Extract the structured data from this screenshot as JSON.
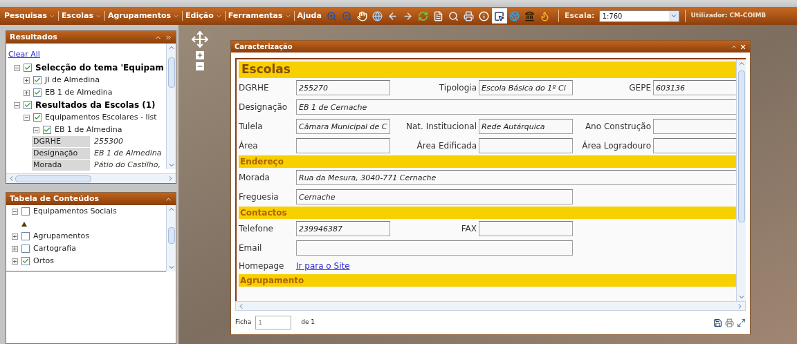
{
  "menu": [
    {
      "label": "Pesquisas",
      "dropdown": true
    },
    {
      "label": "Escolas",
      "dropdown": true
    },
    {
      "label": "Agrupamentos",
      "dropdown": true
    },
    {
      "label": "Edição",
      "dropdown": true
    },
    {
      "label": "Ferramentas",
      "dropdown": true
    },
    {
      "label": "Ajuda",
      "dropdown": false
    }
  ],
  "tools": [
    {
      "kind": "zoom-in",
      "selected": false
    },
    {
      "kind": "zoom-out",
      "selected": false
    },
    {
      "kind": "pan",
      "selected": false
    },
    {
      "kind": "globe",
      "selected": false
    },
    {
      "kind": "back",
      "selected": false
    },
    {
      "kind": "forward",
      "selected": false
    },
    {
      "kind": "refresh",
      "selected": false
    },
    {
      "kind": "document",
      "selected": false
    },
    {
      "kind": "find",
      "selected": false
    },
    {
      "kind": "print",
      "selected": false
    },
    {
      "kind": "info",
      "selected": false
    },
    {
      "kind": "select",
      "selected": true
    },
    {
      "kind": "earth",
      "selected": false
    },
    {
      "kind": "landmark",
      "selected": false
    },
    {
      "kind": "flame",
      "selected": false
    }
  ],
  "scale": {
    "label": "Escala:",
    "value": "1:760"
  },
  "user": "Utilizador: CM-COIMB",
  "results": {
    "title": "Resultados",
    "clear_all": "Clear All",
    "tree": [
      {
        "label": "Selecção do tema 'Equipam",
        "checked": true,
        "expanded": true,
        "children": [
          {
            "label": "JI de Almedina",
            "checked": true,
            "expanded": false
          },
          {
            "label": "EB 1 de Almedina",
            "checked": true,
            "expanded": false
          }
        ]
      },
      {
        "label": "Resultados da Escolas (1)",
        "checked": true,
        "expanded": true,
        "children": [
          {
            "label": "Equipamentos Escolares - list",
            "checked": true,
            "expanded": true,
            "children": [
              {
                "label": "EB 1 de Almedina",
                "checked": true,
                "expanded": true,
                "attributes": [
                  {
                    "label": "DGRHE",
                    "value": "255300"
                  },
                  {
                    "label": "Designação",
                    "value": "EB 1 de Almedina"
                  },
                  {
                    "label": "Morada",
                    "value": "Pátio do Castilho,"
                  }
                ]
              }
            ]
          }
        ]
      }
    ]
  },
  "contents": {
    "title": "Tabela de Conteúdos",
    "tree": [
      {
        "label": "Equipamentos Sociais",
        "checked": false,
        "expanded": true,
        "legend_symbol": true
      },
      {
        "label": "Agrupamentos",
        "checked": false,
        "expanded": false
      },
      {
        "label": "Cartografia",
        "checked": false,
        "expanded": false
      },
      {
        "label": "Ortos",
        "checked": true,
        "expanded": false
      }
    ]
  },
  "dialog": {
    "title": "Caracterização",
    "sections": [
      {
        "kind": "main",
        "title": "Escolas",
        "rows": [
          [
            {
              "label": "DGRHE",
              "value": "255270",
              "kind": "short"
            },
            {
              "label": "Tipologia",
              "value": "Escola Básica do 1º Ci",
              "kind": "short"
            },
            {
              "label": "GEPE",
              "value": "603136",
              "kind": "short"
            }
          ],
          [
            {
              "label": "Designação",
              "value": "EB 1 de Cernache",
              "kind": "long"
            }
          ],
          [
            {
              "label": "Tulela",
              "value": "Câmara Municipal de C",
              "kind": "short"
            },
            {
              "label": "Nat. Institucional",
              "value": "Rede Autárquica",
              "kind": "short"
            },
            {
              "label": "Ano Construção",
              "kind": "short"
            }
          ],
          [
            {
              "label": "Área",
              "kind": "short"
            },
            {
              "label": "Área Edificada",
              "kind": "short"
            },
            {
              "label": "Área Logradouro",
              "kind": "short"
            }
          ]
        ]
      },
      {
        "kind": "sub",
        "title": "Endereço",
        "rows": [
          [
            {
              "label": "Morada",
              "value": "Rua da Mesura, 3040-771 Cernache",
              "kind": "long"
            }
          ],
          [
            {
              "label": "Freguesia",
              "value": "Cernache",
              "kind": "medium"
            }
          ]
        ]
      },
      {
        "kind": "sub",
        "title": "Contactos",
        "rows": [
          [
            {
              "label": "Telefone",
              "value": "239946387",
              "kind": "short"
            },
            {
              "label": "FAX",
              "kind": "short"
            }
          ],
          [
            {
              "label": "Email",
              "kind": "medium"
            }
          ],
          [
            {
              "label": "Homepage",
              "value": "Ir para o Site",
              "kind": "link"
            }
          ]
        ]
      },
      {
        "kind": "sub",
        "title": "Agrupamento"
      }
    ],
    "footer": {
      "record_label": "Ficha",
      "record_value": "1",
      "of": "de 1"
    }
  }
}
